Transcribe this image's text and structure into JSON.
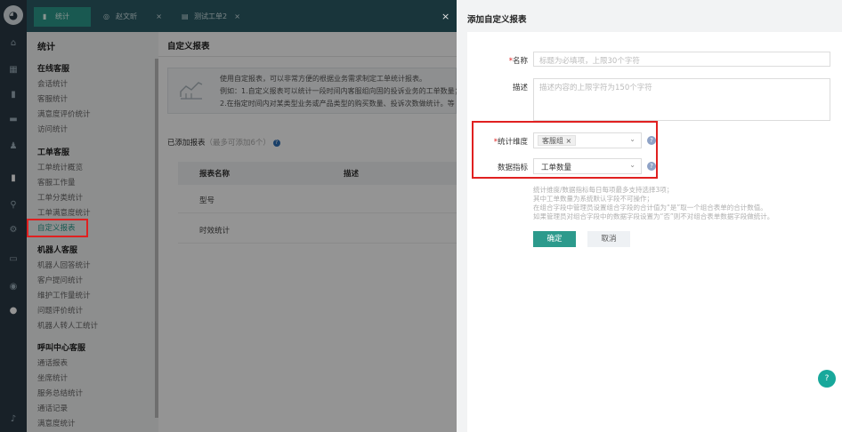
{
  "rail": {
    "icons": [
      "home-icon",
      "apps-icon",
      "trash-icon",
      "chat-icon",
      "user-icon",
      "stats-icon",
      "search-icon",
      "settings-icon",
      "monitor-icon",
      "globe-icon",
      "info-icon",
      "bell-icon"
    ]
  },
  "tabs": [
    {
      "label": "统计",
      "icon": "chart-icon",
      "close": "×"
    },
    {
      "label": "赵文昕",
      "icon": "user-icon",
      "close": "×"
    },
    {
      "label": "测试工单2",
      "icon": "ticket-icon",
      "close": "×"
    }
  ],
  "sidenav": {
    "title": "统计",
    "groups": [
      {
        "label": "在线客服",
        "items": [
          "会话统计",
          "客服统计",
          "满意度评价统计",
          "访问统计"
        ]
      },
      {
        "label": "工单客服",
        "items": [
          "工单统计概览",
          "客服工作量",
          "工单分类统计",
          "工单满意度统计",
          "自定义报表"
        ]
      },
      {
        "label": "机器人客服",
        "items": [
          "机器人回答统计",
          "客户提问统计",
          "维护工作量统计",
          "问题评价统计",
          "机器人转人工统计"
        ]
      },
      {
        "label": "呼叫中心客服",
        "items": [
          "通话报表",
          "坐席统计",
          "服务总结统计",
          "通话记录",
          "满意度统计"
        ]
      }
    ]
  },
  "main": {
    "title": "自定义报表",
    "info_lines": [
      "使用自定报表，可以非常方便的根据业务需求制定工单统计报表。",
      "例如：1.自定义报表可以统计一段时间内客服组向固的投诉业务的工单数量；",
      "2.在指定时间内对某类型业务或产品类型的购买数量、投诉次数做统计。等"
    ],
    "reports_header": "已添加报表",
    "reports_hint": "（最多可添加6个）",
    "columns": [
      "报表名称",
      "描述"
    ],
    "rows": [
      "型号",
      "时效统计"
    ]
  },
  "drawer": {
    "title": "添加自定义报表",
    "close": "×",
    "name_label": "名称",
    "name_placeholder": "标题为必填项，上限30个字符",
    "desc_label": "描述",
    "desc_placeholder": "描述内容的上限字符为150个字符",
    "dimension_label": "统计维度",
    "dimension_tag": "客服组 ×",
    "metric_label": "数据指标",
    "metric_value": "工单数量",
    "help_glyph": "?",
    "notes": [
      "统计维度/数据指标每日每项最多支持选择3项；",
      "其中工单数量为系统默认字段不可操作；",
      "在组合字段中管理员设置组合字段的合计值为“是”取一个组合表单的合计数值。",
      "如果管理员对组合字段中的数据字段设置为“否”则不对组合表单数据字段做统计。"
    ],
    "confirm": "确定",
    "cancel": "取消"
  },
  "float_button": "?"
}
